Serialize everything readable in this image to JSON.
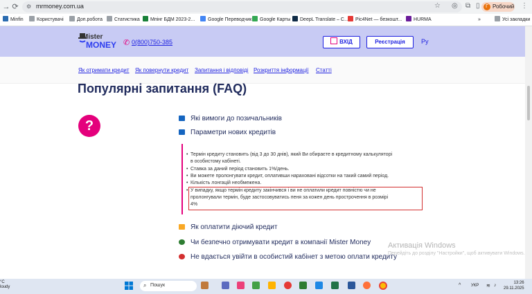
{
  "browser": {
    "url": "mrmoney.com.ua",
    "profile_initial": "Г",
    "profile_label": "Робочий",
    "bookmarks": [
      {
        "label": "Minfin",
        "color": "#2b6cb0"
      },
      {
        "label": "Користувачі",
        "color": "#9aa0a6"
      },
      {
        "label": "Доп.робота",
        "color": "#9aa0a6"
      },
      {
        "label": "Статистика",
        "color": "#9aa0a6"
      },
      {
        "label": "Мпінг БДМ 2023-2...",
        "color": "#188038"
      },
      {
        "label": "Google Переводчик",
        "color": "#4285f4"
      },
      {
        "label": "Google Карты",
        "color": "#34a853"
      },
      {
        "label": "DeepL Translate – С...",
        "color": "#0f2b46"
      },
      {
        "label": "Pic4Net — безкошт...",
        "color": "#e53935"
      },
      {
        "label": "HURMA",
        "color": "#6a1b9a"
      }
    ],
    "all_bookmarks": "Усі закладки"
  },
  "header": {
    "logo_top": "Mister",
    "logo_bottom": "MONEY",
    "phone": "0(800)750-385",
    "login_label": "ВХІД",
    "register_label": "Реєстрація",
    "lang": "Ру"
  },
  "nav": {
    "links": [
      "Як отримати кредит",
      "Як повернути кредит",
      "Запитання і відповіді",
      "Розкриття інформації",
      "Статті"
    ]
  },
  "faq": {
    "title": "Популярні запитання (FAQ)",
    "items": [
      {
        "label": "Які вимоги до позичальників",
        "icon_color": "#1565c0"
      },
      {
        "label": "Параметри нових кредитів",
        "icon_color": "#1565c0"
      },
      {
        "label": "Як оплатити діючий кредит",
        "icon_color": "#f9a825"
      },
      {
        "label": "Чи безпечно отримувати кредит в компанії Mister Money",
        "icon_color": "#2e7d32"
      },
      {
        "label": "Не вдається увійти в особистий кабінет з метою оплати кредиту",
        "icon_color": "#d32f2f"
      }
    ],
    "answer": [
      "Термін кредиту становить (від 3 до 30 днів), який Ви обираєте в кредитному калькуляторі",
      "в особистому кабінеті.",
      "Ставка за даний період становить 1%/день.",
      "Ви можете пролонгувати кредит, оплативши нараховані відсотки на такий самий період.",
      "Кількість лонгацій необмежена.",
      "У випадку, якщо термін кредиту закінчився і ви не оплатили кредит повністю чи не",
      "пролонгували термін, буде застосовуватись пеня за кожен день прострочення в розмірі",
      "4%"
    ]
  },
  "watermark": {
    "title": "Активація Windows",
    "subtitle": "Перейдіть до розділу \"Настройки\", щоб активувати Windows."
  },
  "taskbar": {
    "weather_temp": "°C",
    "weather_desc": "loudy",
    "search_label": "Пошук",
    "lang": "УКР",
    "time": "13:26",
    "date": "29.11.2025"
  }
}
